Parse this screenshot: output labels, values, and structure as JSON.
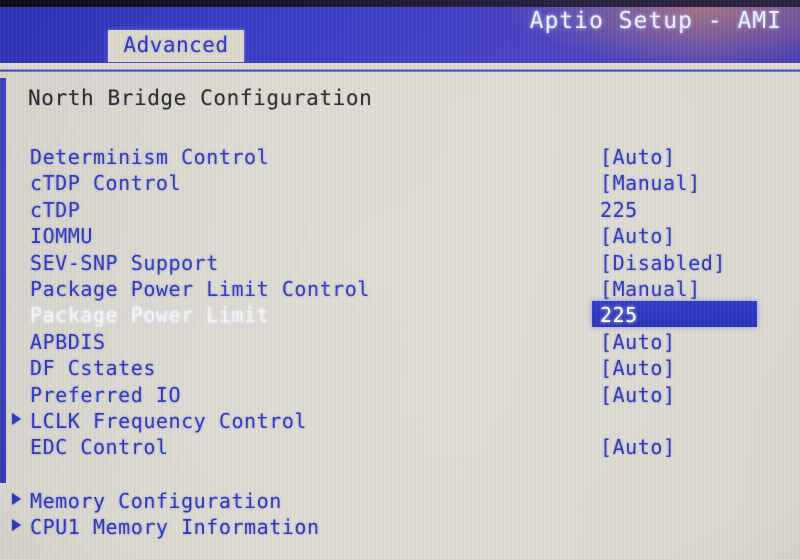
{
  "header": {
    "title": "Aptio Setup - AMI",
    "tab": "Advanced",
    "accent_blue": "#3639c6",
    "background_beige": "#dedbd3"
  },
  "page": {
    "title": "North Bridge Configuration"
  },
  "menu": {
    "items": [
      {
        "label": "Determinism Control",
        "value": "[Auto]",
        "submenu": false,
        "selected": false
      },
      {
        "label": "cTDP Control",
        "value": "[Manual]",
        "submenu": false,
        "selected": false
      },
      {
        "label": "cTDP",
        "value": "225",
        "submenu": false,
        "selected": false
      },
      {
        "label": "IOMMU",
        "value": "[Auto]",
        "submenu": false,
        "selected": false
      },
      {
        "label": "SEV-SNP Support",
        "value": "[Disabled]",
        "submenu": false,
        "selected": false
      },
      {
        "label": "Package Power Limit Control",
        "value": "[Manual]",
        "submenu": false,
        "selected": false
      },
      {
        "label": "Package Power Limit",
        "value": "225",
        "submenu": false,
        "selected": true
      },
      {
        "label": "APBDIS",
        "value": "[Auto]",
        "submenu": false,
        "selected": false
      },
      {
        "label": "DF Cstates",
        "value": "[Auto]",
        "submenu": false,
        "selected": false
      },
      {
        "label": "Preferred IO",
        "value": "[Auto]",
        "submenu": false,
        "selected": false
      },
      {
        "label": "LCLK Frequency Control",
        "value": "",
        "submenu": true,
        "selected": false
      },
      {
        "label": "EDC Control",
        "value": "[Auto]",
        "submenu": false,
        "selected": false
      }
    ],
    "group2": [
      {
        "label": "Memory Configuration",
        "value": "",
        "submenu": true,
        "selected": false
      },
      {
        "label": "CPU1 Memory Information",
        "value": "",
        "submenu": true,
        "selected": false
      }
    ]
  },
  "icons": {
    "submenu": "triangle-right-icon"
  }
}
